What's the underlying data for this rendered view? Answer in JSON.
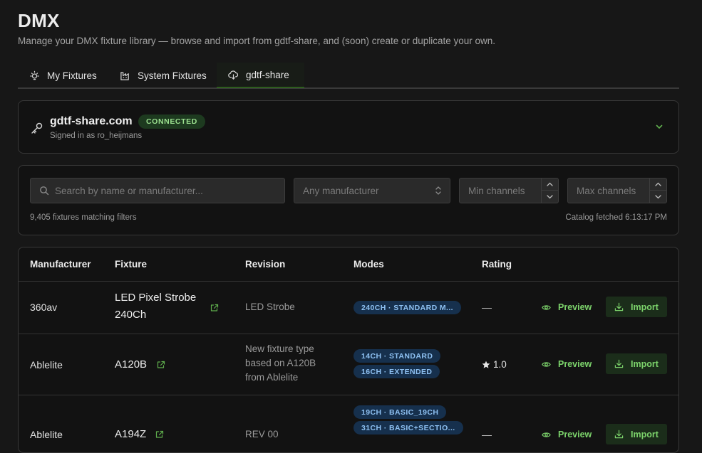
{
  "header": {
    "title": "DMX",
    "subtitle": "Manage your DMX fixture library — browse and import from gdtf-share, and (soon) create or duplicate your own."
  },
  "tabs": [
    {
      "label": "My Fixtures",
      "icon": "bulb-icon"
    },
    {
      "label": "System Fixtures",
      "icon": "factory-icon"
    },
    {
      "label": "gdtf-share",
      "icon": "cloud-download-icon",
      "active": true
    }
  ],
  "connection": {
    "name": "gdtf-share.com",
    "status": "CONNECTED",
    "signed_in": "Signed in as ro_heijmans"
  },
  "filters": {
    "search_placeholder": "Search by name or manufacturer...",
    "manufacturer_placeholder": "Any manufacturer",
    "min_channels_placeholder": "Min channels",
    "max_channels_placeholder": "Max channels",
    "count": "9,405 fixtures matching filters",
    "fetched": "Catalog fetched 6:13:17 PM"
  },
  "table": {
    "columns": [
      "Manufacturer",
      "Fixture",
      "Revision",
      "Modes",
      "Rating"
    ],
    "preview_label": "Preview",
    "import_label": "Import",
    "rows": [
      {
        "manufacturer": "360av",
        "fixture_lines": [
          "LED Pixel Strobe",
          "240Ch"
        ],
        "revision_lines": [
          "LED Strobe"
        ],
        "modes": [
          "240CH · STANDARD M..."
        ],
        "rating": "—"
      },
      {
        "manufacturer": "Ablelite",
        "fixture_lines": [
          "A120B"
        ],
        "revision_lines": [
          "New fixture type",
          "based on A120B",
          "from Ablelite"
        ],
        "modes": [
          "14CH · STANDARD",
          "16CH · EXTENDED"
        ],
        "rating": "1.0"
      },
      {
        "manufacturer": "Ablelite",
        "fixture_lines": [
          "A194Z"
        ],
        "revision_lines": [
          "REV 00"
        ],
        "modes": [
          "19CH · BASIC_19CH",
          "31CH · BASIC+SECTIO..."
        ],
        "rating": "—"
      }
    ]
  },
  "colors": {
    "accent_green": "#7cd36b",
    "badge_green_bg": "#1d3a1f",
    "mode_blue": "#8ec1f2",
    "mode_blue_bg": "#16304d"
  }
}
